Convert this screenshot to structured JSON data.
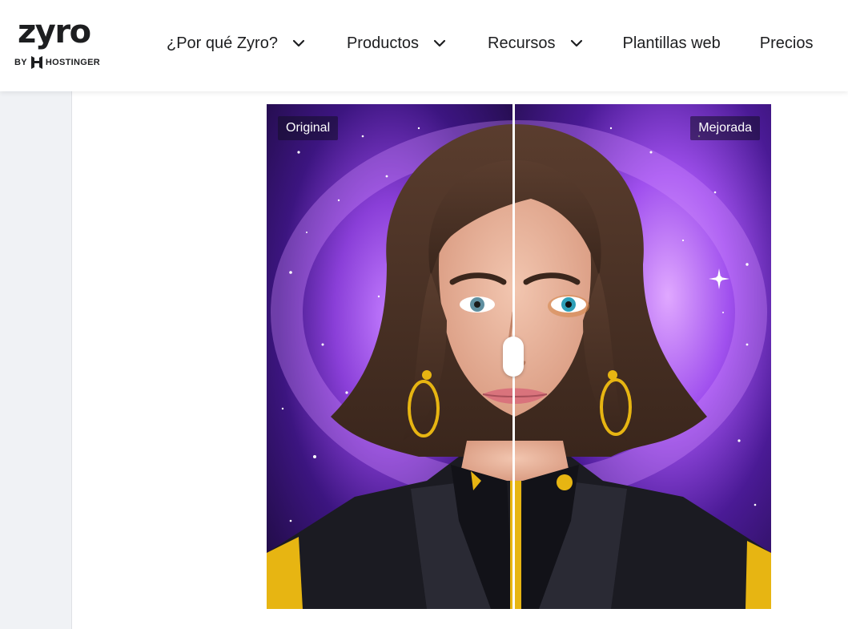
{
  "header": {
    "logo": {
      "word": "zyro",
      "by": "BY",
      "brand": "HOSTINGER"
    },
    "nav": [
      {
        "label": "¿Por qué Zyro?",
        "dropdown": true
      },
      {
        "label": "Productos",
        "dropdown": true
      },
      {
        "label": "Recursos",
        "dropdown": true
      },
      {
        "label": "Plantillas web",
        "dropdown": false
      },
      {
        "label": "Precios",
        "dropdown": false
      }
    ]
  },
  "comparison": {
    "left_label": "Original",
    "right_label": "Mejorada",
    "slider_position": 0.49
  },
  "colors": {
    "text": "#1d1e20",
    "sidebar": "#f0f2f5",
    "space_dark": "#1b0a3a",
    "space_glow": "#c27bff",
    "hair": "#4a3226",
    "jacket_gold": "#e7b512"
  }
}
